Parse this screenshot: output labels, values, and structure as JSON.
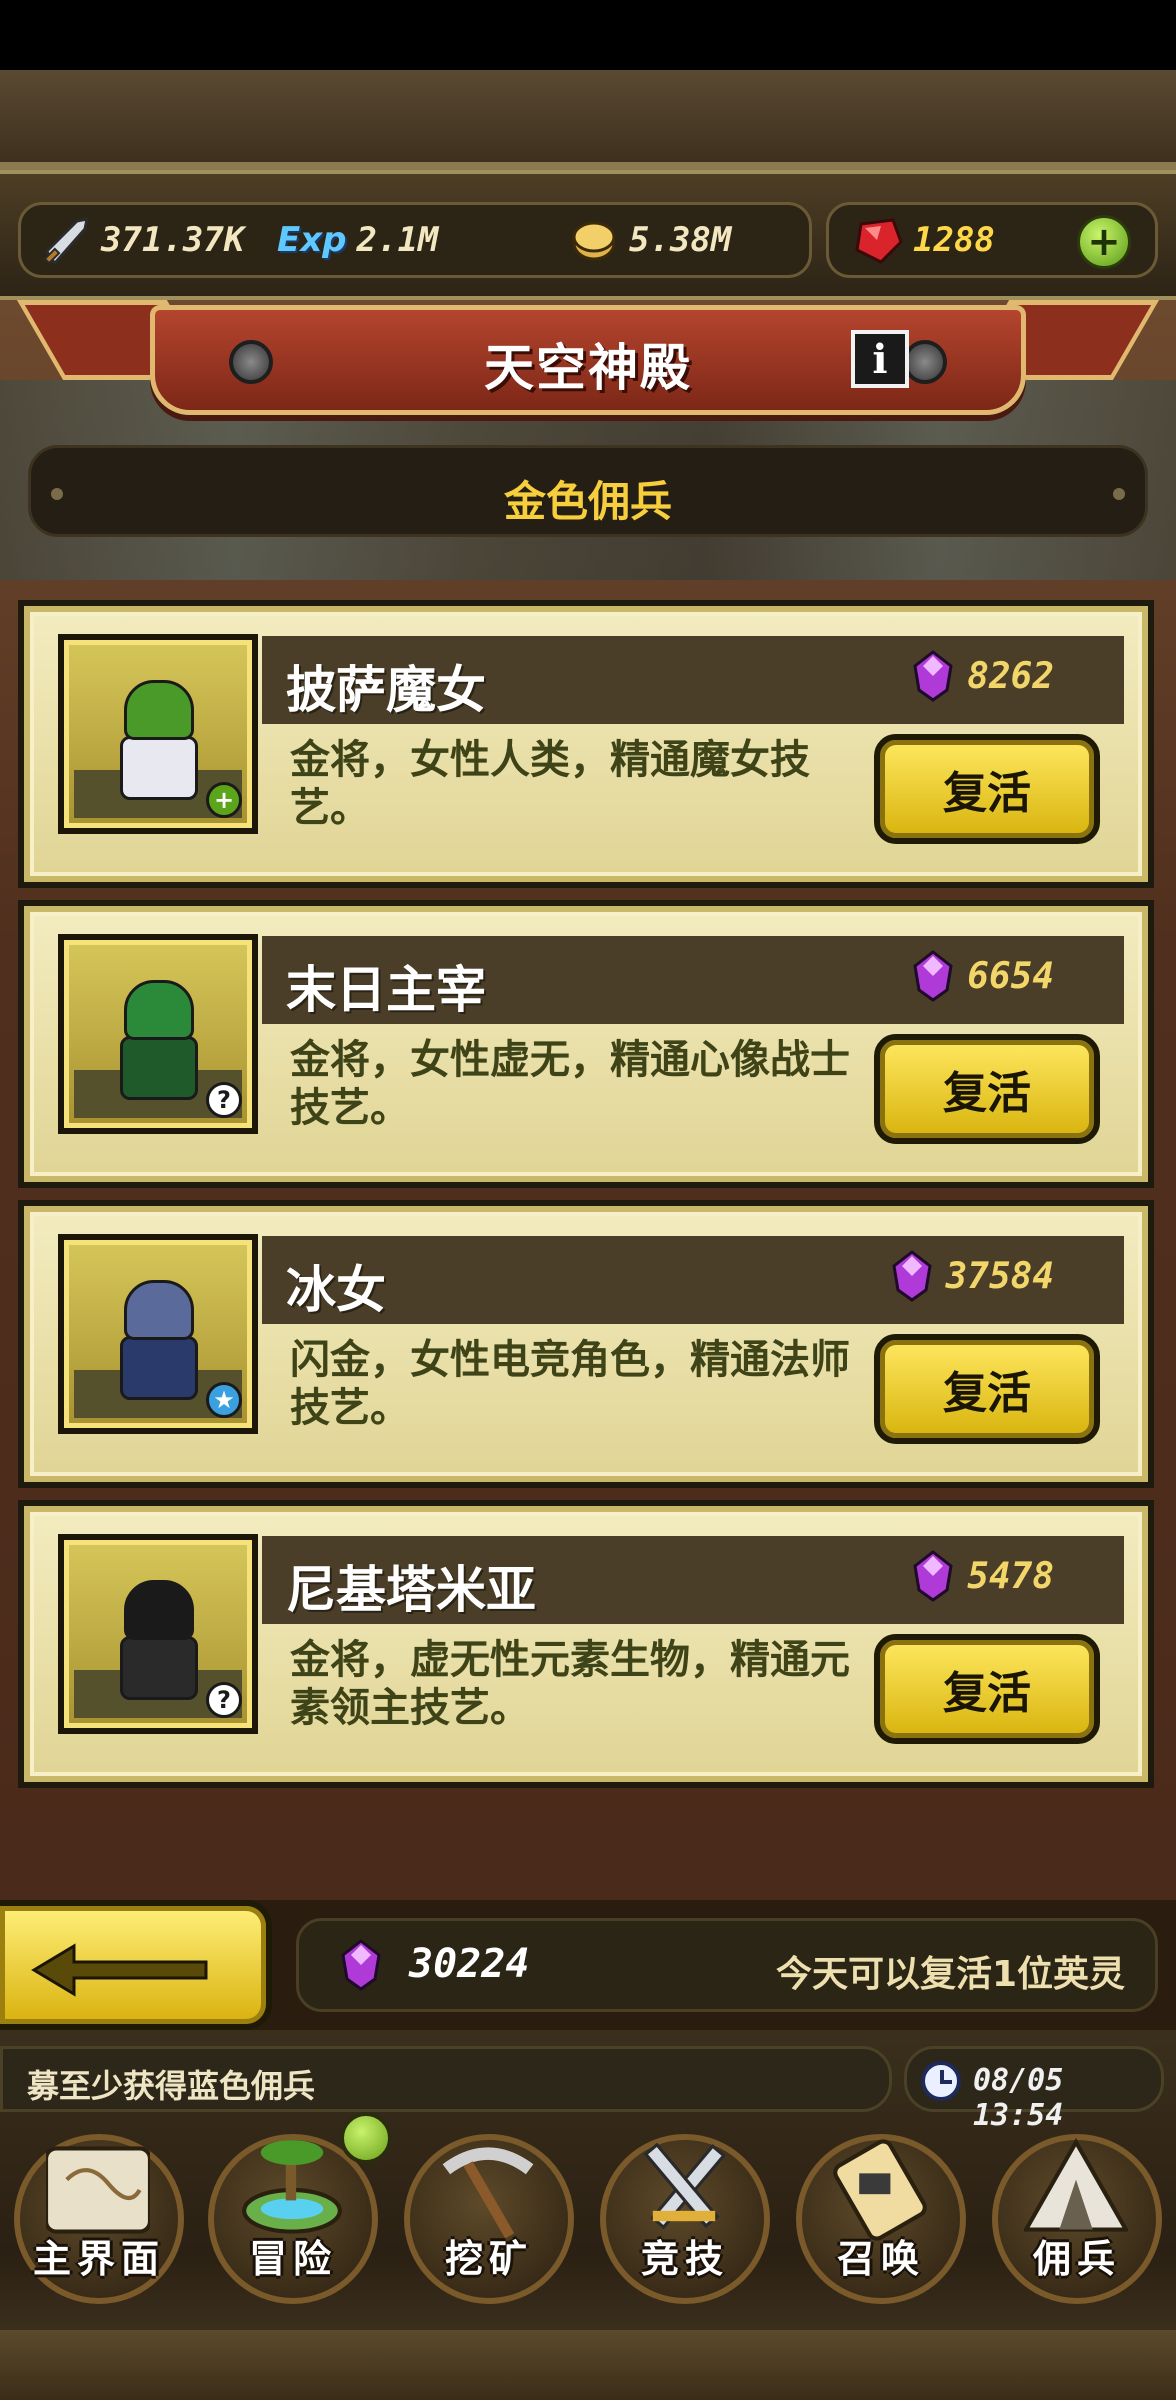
{
  "resources": {
    "power": "371.37K",
    "exp": "2.1M",
    "gold": "5.38M",
    "rubies": "1288",
    "exp_label": "Exp"
  },
  "header": {
    "title": "天空神殿",
    "info_label": "i"
  },
  "category": {
    "label": "金色佣兵"
  },
  "heroes": [
    {
      "name": "披萨魔女",
      "cost": "8262",
      "desc": "金将，女性人类，精通魔女技艺。",
      "action": "复活",
      "badge": "+",
      "badge_color": "#5aa51a",
      "hair": "#4a9a2a",
      "robe": "#e8e8f0"
    },
    {
      "name": "末日主宰",
      "cost": "6654",
      "desc": "金将，女性虚无，精通心像战士技艺。",
      "action": "复活",
      "badge": "?",
      "badge_color": "#ffffff",
      "hair": "#2a8a3a",
      "robe": "#1f5a2a"
    },
    {
      "name": "冰女",
      "cost": "37584",
      "desc": "闪金，女性电竞角色，精通法师技艺。",
      "action": "复活",
      "badge": "★",
      "badge_color": "#3aa0e0",
      "hair": "#5a6a9a",
      "robe": "#2a3a6a"
    },
    {
      "name": "尼基塔米亚",
      "cost": "5478",
      "desc": "金将，虚无性元素生物，精通元素领主技艺。",
      "action": "复活",
      "badge": "?",
      "badge_color": "#ffffff",
      "hair": "#1a1a1a",
      "robe": "#2a2a2a"
    }
  ],
  "footer": {
    "gem_total": "30224",
    "revive_note": "今天可以复活1位英灵"
  },
  "ticker": {
    "text": "募至少获得蓝色佣兵",
    "time": "08/05 13:54"
  },
  "nav": [
    {
      "label": "主界面",
      "icon": "map-scroll-icon"
    },
    {
      "label": "冒险",
      "icon": "island-icon"
    },
    {
      "label": "挖矿",
      "icon": "pickaxe-icon"
    },
    {
      "label": "竞技",
      "icon": "crossed-swords-icon"
    },
    {
      "label": "召唤",
      "icon": "summon-scroll-icon"
    },
    {
      "label": "佣兵",
      "icon": "tent-icon"
    }
  ],
  "colors": {
    "gold_button": "#f2d028",
    "ribbon_red": "#a33a24",
    "card_bg": "#efe6b4",
    "gem_purple": "#b03ad8"
  }
}
